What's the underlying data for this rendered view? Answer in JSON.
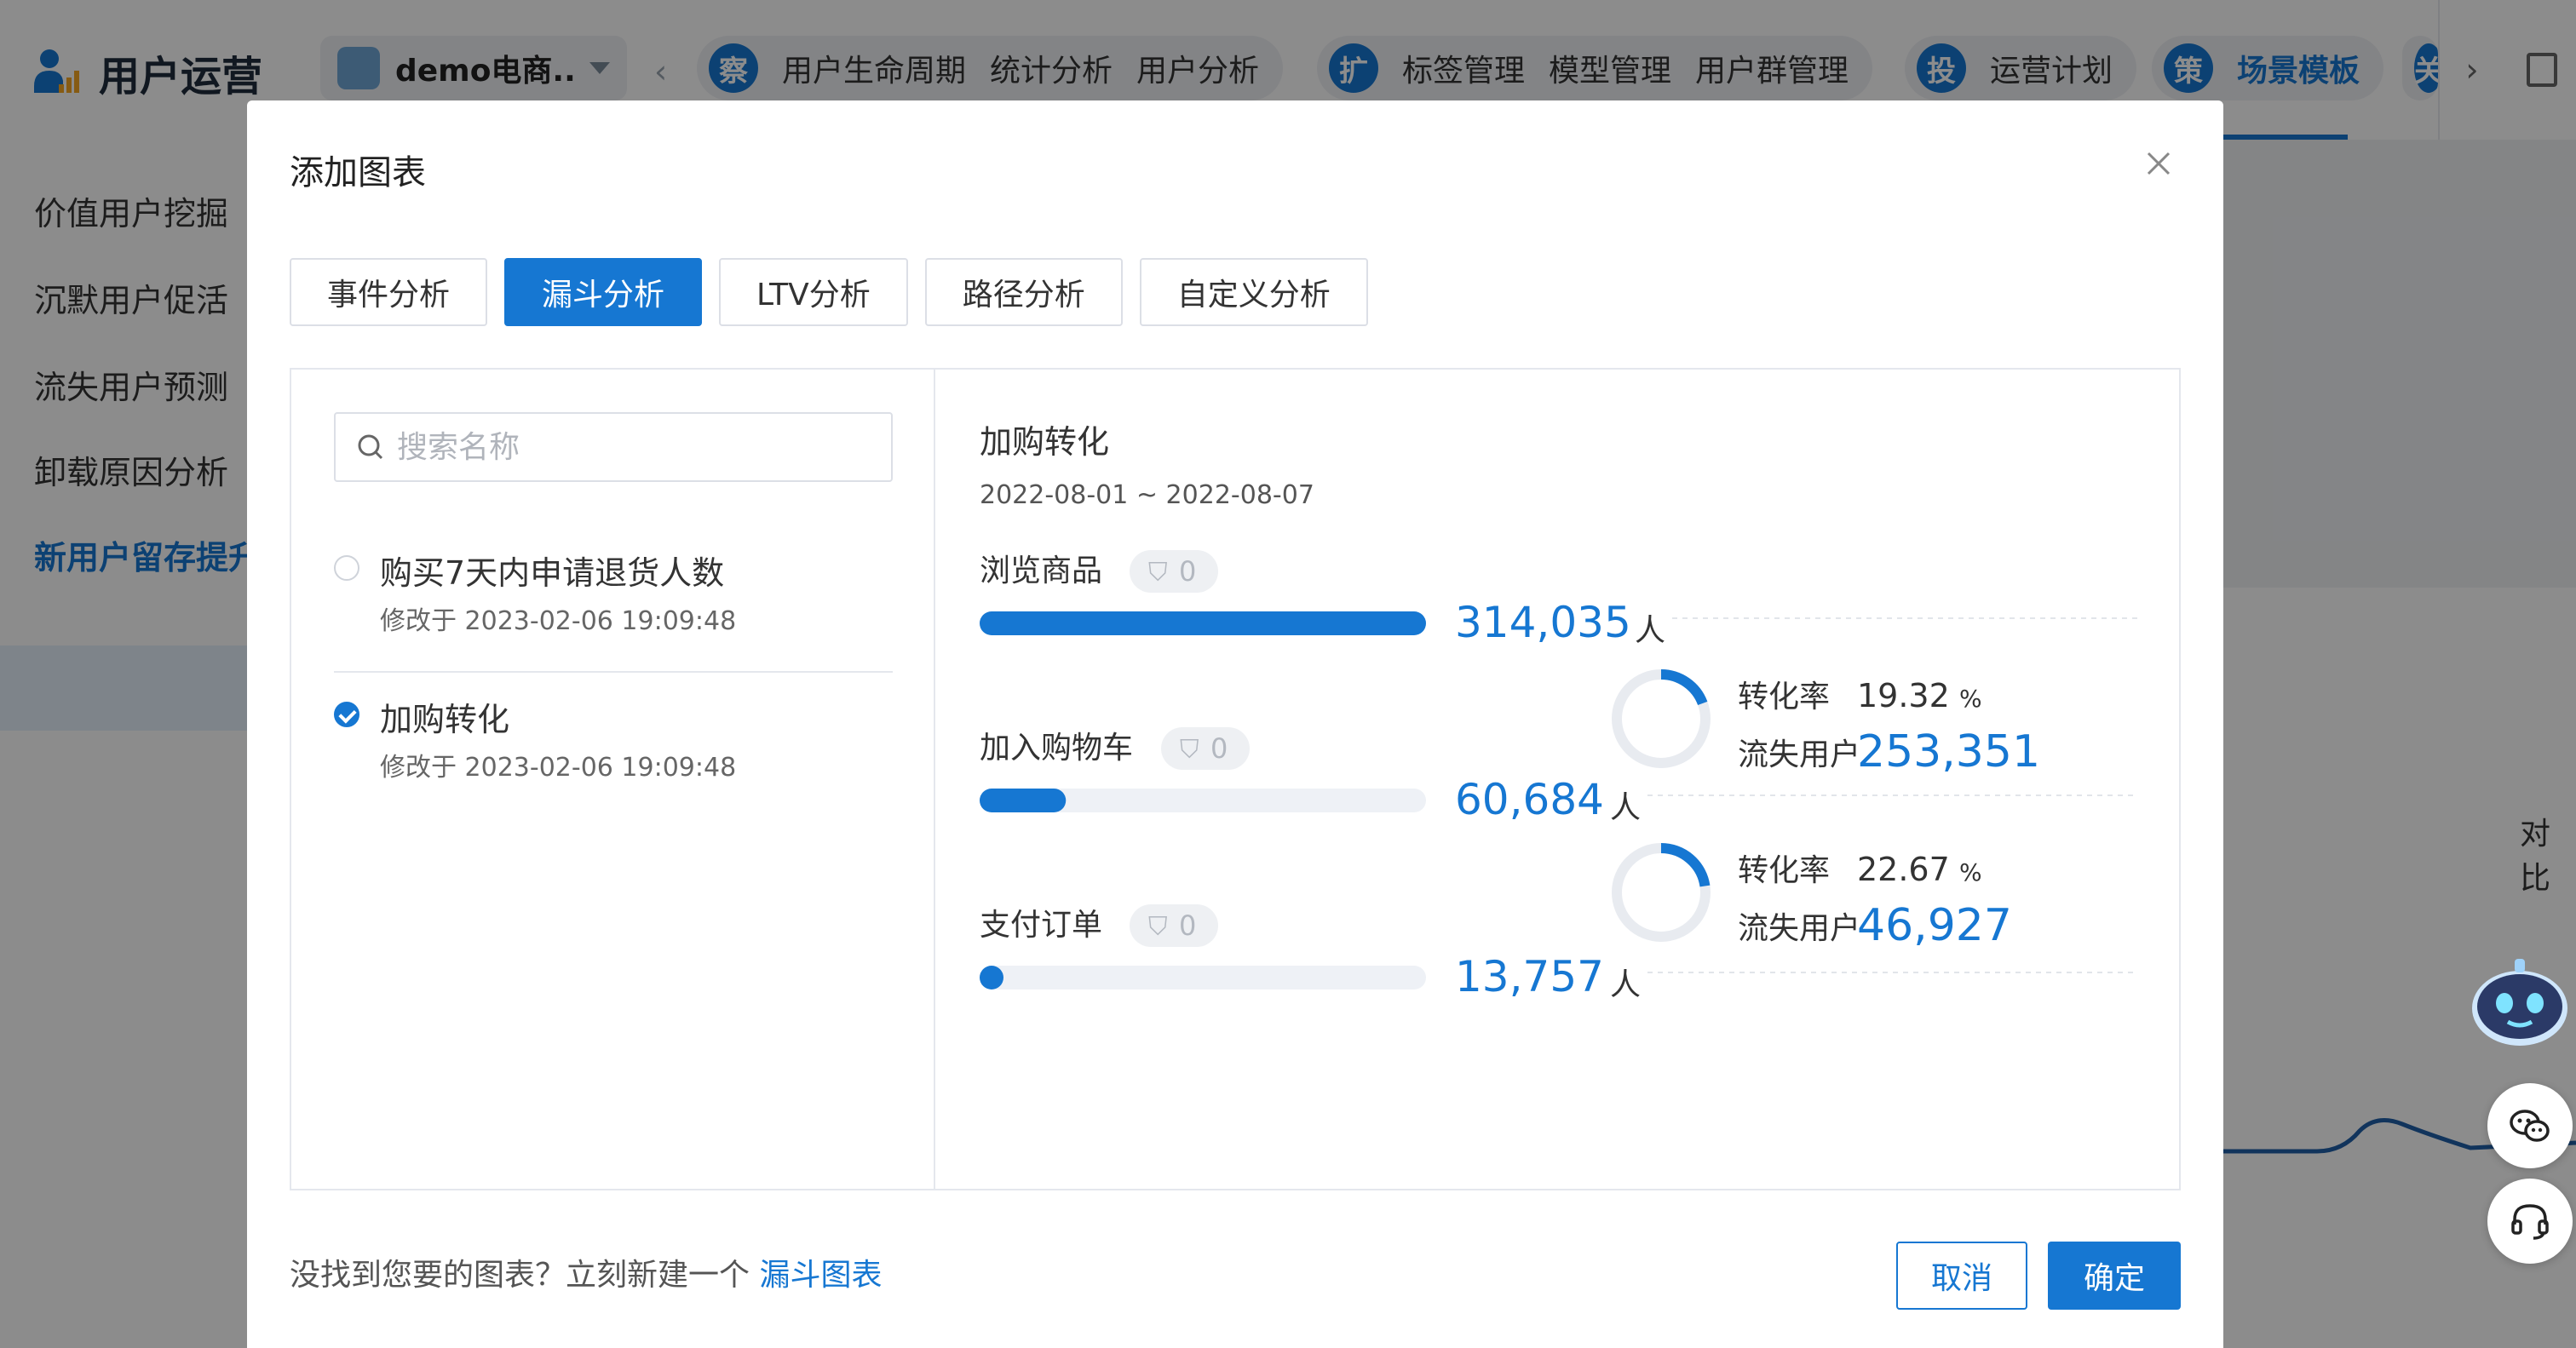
{
  "app": {
    "name": "用户运营",
    "project": "demo电商...",
    "nav_left_arrow": "‹",
    "nav_right_arrow": "›",
    "nav_groups": [
      {
        "badge": "察",
        "items": [
          "用户生命周期",
          "统计分析",
          "用户分析"
        ]
      },
      {
        "badge": "扩",
        "items": [
          "标签管理",
          "模型管理",
          "用户群管理"
        ]
      },
      {
        "badge": "投",
        "items": [
          "运营计划"
        ]
      },
      {
        "badge": "策",
        "items": [
          "场景模板"
        ]
      }
    ],
    "nav_partial_badge": "关",
    "active_nav": "场景模板"
  },
  "sidebar": {
    "items": [
      "价值用户挖掘",
      "沉默用户促活",
      "流失用户预测",
      "卸载原因分析",
      "新用户留存提升"
    ],
    "active": "新用户留存提升"
  },
  "background": {
    "compare_label": "对比"
  },
  "modal": {
    "title": "添加图表",
    "tabs": [
      "事件分析",
      "漏斗分析",
      "LTV分析",
      "路径分析",
      "自定义分析"
    ],
    "active_tab": "漏斗分析",
    "search_placeholder": "搜索名称",
    "list": [
      {
        "title": "购买7天内申请退货人数",
        "modified": "修改于 2023-02-06 19:09:48",
        "checked": false
      },
      {
        "title": "加购转化",
        "modified": "修改于 2023-02-06 19:09:48",
        "checked": true
      }
    ],
    "footer": {
      "prompt": "没找到您要的图表？立刻新建一个",
      "link": "漏斗图表",
      "cancel": "取消",
      "confirm": "确定"
    }
  },
  "chart_data": {
    "type": "funnel",
    "title": "加购转化",
    "date_range": "2022-08-01 ~ 2022-08-07",
    "unit": "人",
    "steps": [
      {
        "name": "浏览商品",
        "filter_count": "0",
        "value": 314035,
        "value_label": "314,035"
      },
      {
        "name": "加入购物车",
        "filter_count": "0",
        "value": 60684,
        "value_label": "60,684"
      },
      {
        "name": "支付订单",
        "filter_count": "0",
        "value": 13757,
        "value_label": "13,757"
      }
    ],
    "conversions": [
      {
        "rate_label": "转化率",
        "rate": 19.32,
        "rate_text": "19.32",
        "rate_unit": "%",
        "lost_label": "流失用户",
        "lost": "253,351"
      },
      {
        "rate_label": "转化率",
        "rate": 22.67,
        "rate_text": "22.67",
        "rate_unit": "%",
        "lost_label": "流失用户",
        "lost": "46,927"
      }
    ],
    "colors": {
      "primary": "#1677d2",
      "bar_track": "#eef1f6",
      "ring_track": "#e8ebf0",
      "badge_bg": "#eef0f3",
      "badge_text": "#b3b8c0"
    }
  }
}
